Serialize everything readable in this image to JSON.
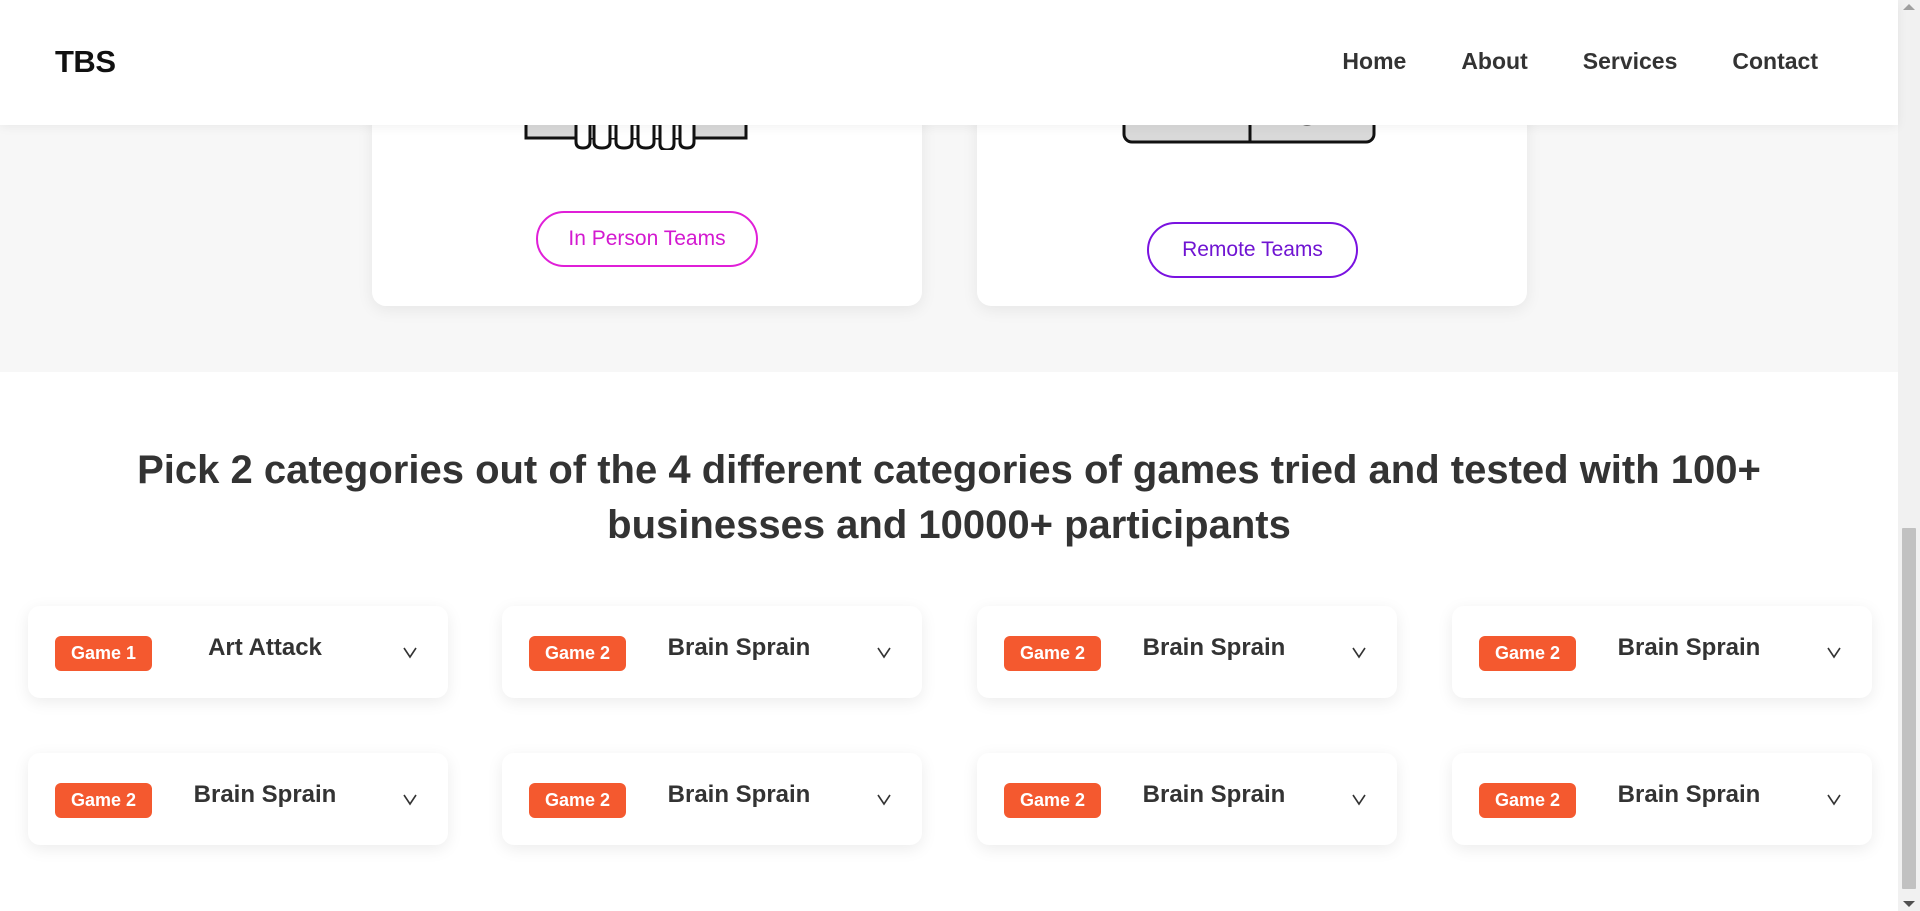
{
  "header": {
    "logo": "TBS",
    "nav": [
      "Home",
      "About",
      "Services",
      "Contact"
    ]
  },
  "cards": [
    {
      "button_label": "In Person Teams",
      "color": "#d319d0"
    },
    {
      "button_label": "Remote Teams",
      "color": "#7014d2"
    }
  ],
  "section": {
    "heading": "Pick 2 categories out of the 4 different categories of games tried and tested with 100+ businesses and 10000+ participants"
  },
  "games": [
    {
      "badge": "Game 1",
      "name": "Art Attack"
    },
    {
      "badge": "Game 2",
      "name": "Brain Sprain"
    },
    {
      "badge": "Game 2",
      "name": "Brain Sprain"
    },
    {
      "badge": "Game 2",
      "name": "Brain Sprain"
    },
    {
      "badge": "Game 2",
      "name": "Brain Sprain"
    },
    {
      "badge": "Game 2",
      "name": "Brain Sprain"
    },
    {
      "badge": "Game 2",
      "name": "Brain Sprain"
    },
    {
      "badge": "Game 2",
      "name": "Brain Sprain"
    }
  ],
  "colors": {
    "badge": "#f4592f",
    "in_person_accent": "#e01fd8",
    "remote_accent": "#7a12e0"
  }
}
